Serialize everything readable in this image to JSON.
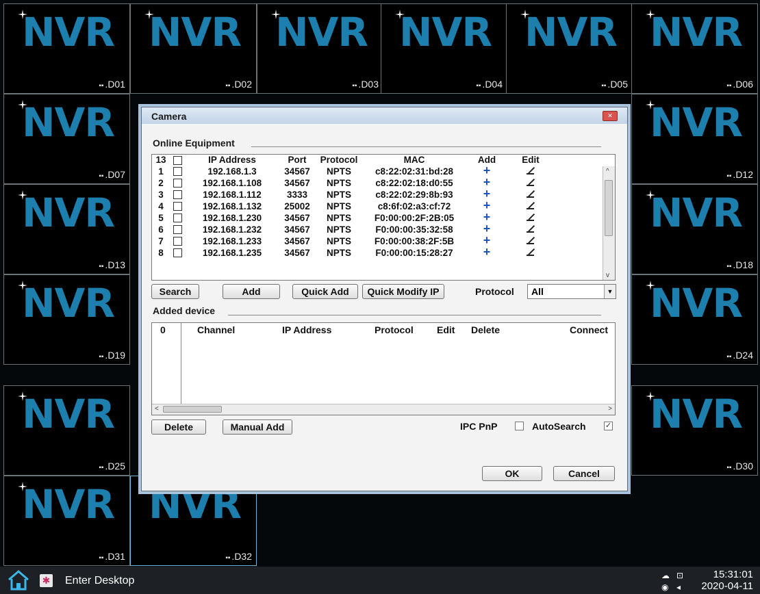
{
  "tiles": [
    {
      "logo": "NVR",
      "label": "D01"
    },
    {
      "logo": "NVR",
      "label": "D02"
    },
    {
      "logo": "NVR",
      "label": "D03"
    },
    {
      "logo": "NVR",
      "label": "D04"
    },
    {
      "logo": "NVR",
      "label": "D05"
    },
    {
      "logo": "NVR",
      "label": "D06"
    },
    {
      "logo": "NVR",
      "label": "D07"
    },
    {
      "logo": "NVR",
      "label": "D12"
    },
    {
      "logo": "NVR",
      "label": "D13"
    },
    {
      "logo": "NVR",
      "label": "D18"
    },
    {
      "logo": "NVR",
      "label": "D19"
    },
    {
      "logo": "NVR",
      "label": "D24"
    },
    {
      "logo": "NVR",
      "label": "D25"
    },
    {
      "logo": "NVR",
      "label": "D30"
    },
    {
      "logo": "NVR",
      "label": "D31"
    },
    {
      "logo": "NVR",
      "label": "D32"
    }
  ],
  "dialog": {
    "title": "Camera",
    "online_section": "Online Equipment",
    "online_table": {
      "count": "13",
      "headers": [
        "IP Address",
        "Port",
        "Protocol",
        "MAC",
        "Add",
        "Edit"
      ],
      "rows": [
        {
          "num": "1",
          "ip": "192.168.1.3",
          "port": "34567",
          "protocol": "NPTS",
          "mac": "c8:22:02:31:bd:28"
        },
        {
          "num": "2",
          "ip": "192.168.1.108",
          "port": "34567",
          "protocol": "NPTS",
          "mac": "c8:22:02:18:d0:55"
        },
        {
          "num": "3",
          "ip": "192.168.1.112",
          "port": "3333",
          "protocol": "NPTS",
          "mac": "c8:22:02:29:8b:93"
        },
        {
          "num": "4",
          "ip": "192.168.1.132",
          "port": "25002",
          "protocol": "NPTS",
          "mac": "c8:6f:02:a3:cf:72"
        },
        {
          "num": "5",
          "ip": "192.168.1.230",
          "port": "34567",
          "protocol": "NPTS",
          "mac": "F0:00:00:2F:2B:05"
        },
        {
          "num": "6",
          "ip": "192.168.1.232",
          "port": "34567",
          "protocol": "NPTS",
          "mac": "F0:00:00:35:32:58"
        },
        {
          "num": "7",
          "ip": "192.168.1.233",
          "port": "34567",
          "protocol": "NPTS",
          "mac": "F0:00:00:38:2F:5B"
        },
        {
          "num": "8",
          "ip": "192.168.1.235",
          "port": "34567",
          "protocol": "NPTS",
          "mac": "F0:00:00:15:28:27"
        }
      ]
    },
    "buttons": {
      "search": "Search",
      "add": "Add",
      "quick_add": "Quick Add",
      "quick_modify_ip": "Quick Modify IP",
      "delete": "Delete",
      "manual_add": "Manual Add",
      "ok": "OK",
      "cancel": "Cancel"
    },
    "protocol_label": "Protocol",
    "protocol_value": "All",
    "added_section": "Added device",
    "added_table": {
      "count": "0",
      "headers": [
        "Channel",
        "IP Address",
        "Protocol",
        "Edit",
        "Delete",
        "Connect"
      ]
    },
    "ipc_pnp_label": "IPC PnP",
    "ipc_pnp_checked": false,
    "autosearch_label": "AutoSearch",
    "autosearch_checked": true
  },
  "taskbar": {
    "enter_desktop": "Enter Desktop",
    "time": "15:31:01",
    "date": "2020-04-11"
  },
  "colors": {
    "logo": "#1c7fae",
    "accent_border": "#6fb6d8",
    "taskbar": "#1d2126"
  }
}
